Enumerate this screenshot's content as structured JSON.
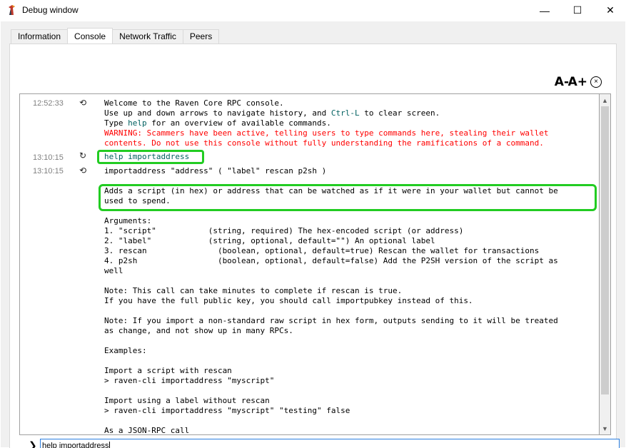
{
  "window": {
    "title": "Debug window",
    "minimize": "—",
    "maximize": "☐",
    "close": "✕"
  },
  "tabs": [
    {
      "label": "Information"
    },
    {
      "label": "Console"
    },
    {
      "label": "Network Traffic"
    },
    {
      "label": "Peers"
    }
  ],
  "active_tab": "Console",
  "toolbar": {
    "font_decrease": "A-",
    "font_increase": "A+",
    "clear": "×"
  },
  "console": {
    "entries": [
      {
        "time": "12:52:33",
        "icon": "reply-icon",
        "lines": [
          "Welcome to the Raven Core RPC console.",
          "Use up and down arrows to navigate history, and ",
          "Type ",
          "WARNING: Scammers have been active, telling users to type commands here, stealing their wallet",
          "contents. Do not use this console without fully understanding the ramifications of a command."
        ],
        "ctrl_l": "Ctrl-L",
        "clear_screen": " to clear screen.",
        "help": "help",
        "overview": " for an overview of available commands."
      },
      {
        "time": "13:10:15",
        "icon": "request-icon",
        "text": "help importaddress"
      },
      {
        "time": "13:10:15",
        "icon": "reply-icon",
        "text": "importaddress \"address\" ( \"label\" rescan p2sh )"
      }
    ],
    "help_body": [
      "Adds a script (in hex) or address that can be watched as if it were in your wallet but cannot be",
      "used to spend.",
      "",
      "Arguments:",
      "1. \"script\"           (string, required) The hex-encoded script (or address)",
      "2. \"label\"            (string, optional, default=\"\") An optional label",
      "3. rescan               (boolean, optional, default=true) Rescan the wallet for transactions",
      "4. p2sh                 (boolean, optional, default=false) Add the P2SH version of the script as",
      "well",
      "",
      "Note: This call can take minutes to complete if rescan is true.",
      "If you have the full public key, you should call importpubkey instead of this.",
      "",
      "Note: If you import a non-standard raw script in hex form, outputs sending to it will be treated",
      "as change, and not show up in many RPCs.",
      "",
      "Examples:",
      "",
      "Import a script with rescan",
      "> raven-cli importaddress \"myscript\"",
      "",
      "Import using a label without rescan",
      "> raven-cli importaddress \"myscript\" \"testing\" false",
      "",
      "As a JSON-RPC call"
    ]
  },
  "input": {
    "value": "help importaddress"
  }
}
